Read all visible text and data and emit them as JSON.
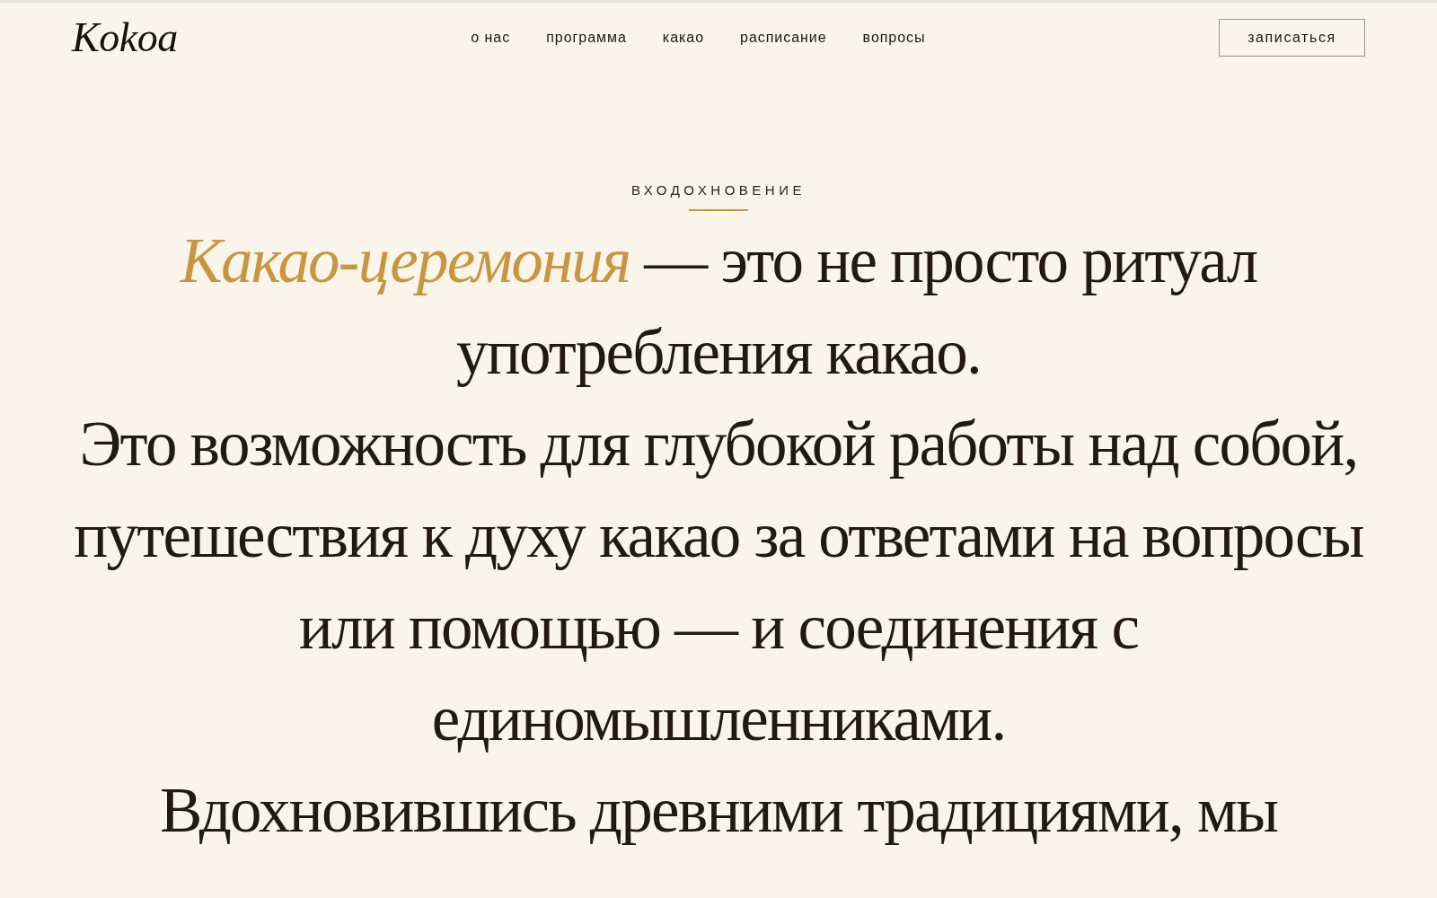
{
  "header": {
    "logo": "Kokoa",
    "nav": [
      "о нас",
      "программа",
      "какао",
      "расписание",
      "вопросы"
    ],
    "cta": "записаться"
  },
  "hero": {
    "eyebrow": "ВХОДОХНОВЕНИЕ",
    "paragraphs": [
      "*Какао-церемония* — это не просто ритуал употребления какао.",
      "Это возможность для глубокой работы над собой, путешествия к духу какао за ответами на вопросы или помощью — и соединения с единомышленниками.",
      "Вдохновившись древними традициями, мы"
    ]
  }
}
